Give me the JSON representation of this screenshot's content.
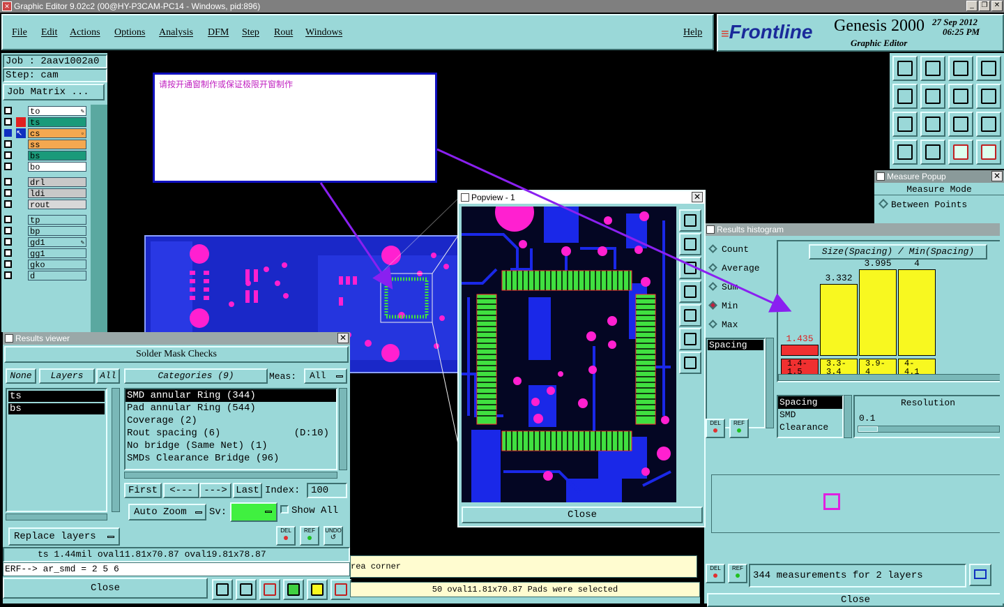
{
  "window_title": "Graphic Editor 9.02c2 (00@HY-P3CAM-PC14 - Windows, pid:896)",
  "menu": {
    "file": "File",
    "edit": "Edit",
    "actions": "Actions",
    "options": "Options",
    "analysis": "Analysis",
    "dfm": "DFM",
    "step": "Step",
    "rout": "Rout",
    "windows": "Windows",
    "help": "Help"
  },
  "brand": {
    "logo": "Frontline",
    "product": "Genesis 2000",
    "subtitle": "Graphic Editor",
    "date": "27 Sep 2012",
    "time": "06:25 PM"
  },
  "job": {
    "job_line": "Job : 2aav1002a0",
    "step_line": "Step: cam",
    "matrix_button": "Job Matrix ..."
  },
  "layers": [
    {
      "name": "to",
      "color": "#ffffff",
      "mark": "",
      "extra": "✎"
    },
    {
      "name": "ts",
      "color": "#1a9a7a",
      "mark": "#e02020",
      "extra": ""
    },
    {
      "name": "cs",
      "color": "#f4a850",
      "mark": "#1030c0",
      "extra": "▫"
    },
    {
      "name": "ss",
      "color": "#f4a850",
      "mark": "",
      "extra": ""
    },
    {
      "name": "bs",
      "color": "#1a9a7a",
      "mark": "",
      "extra": ""
    },
    {
      "name": "bo",
      "color": "#ffffff",
      "mark": "",
      "extra": ""
    },
    {
      "name": "drl",
      "color": "#c8c8c8",
      "mark": "",
      "extra": ""
    },
    {
      "name": "ldi",
      "color": "#c8c8c8",
      "mark": "",
      "extra": ""
    },
    {
      "name": "rout",
      "color": "#d8d8d8",
      "mark": "",
      "extra": ""
    },
    {
      "name": "tp",
      "color": "#9ad8d8",
      "mark": "",
      "extra": ""
    },
    {
      "name": "bp",
      "color": "#9ad8d8",
      "mark": "",
      "extra": ""
    },
    {
      "name": "gd1",
      "color": "#9ad8d8",
      "mark": "",
      "extra": "✎"
    },
    {
      "name": "gg1",
      "color": "#9ad8d8",
      "mark": "",
      "extra": ""
    },
    {
      "name": "gko",
      "color": "#9ad8d8",
      "mark": "",
      "extra": ""
    },
    {
      "name": "d",
      "color": "#9ad8d8",
      "mark": "",
      "extra": ""
    }
  ],
  "note": {
    "text": "请按开通窗制作或保证极限开窗制作"
  },
  "popview": {
    "title": "Popview - 1",
    "close": "Close"
  },
  "measure_popup": {
    "title": "Measure Popup",
    "mode_label": "Measure Mode",
    "option": "Between Points"
  },
  "histogram": {
    "title": "Results histogram",
    "radio": [
      "Count",
      "Average",
      "Sum",
      "Min",
      "Max"
    ],
    "selected": "Min",
    "header": "Size(Spacing) / Min(Spacing)",
    "list_selected": "Spacing",
    "bins": [
      {
        "label": "1.4-\n1.5",
        "value": "1.435",
        "color": "#f03030"
      },
      {
        "label": "3.3-\n3.4",
        "value": "3.332",
        "color": "#f8f820"
      },
      {
        "label": "3.9-\n4",
        "value": "3.995",
        "color": "#f8f820"
      },
      {
        "label": "4-\n4.1",
        "value": "4",
        "color": "#f8f820"
      }
    ],
    "types": [
      "Spacing",
      "SMD",
      "Clearance"
    ],
    "resolution_label": "Resolution",
    "resolution_value": "0.1",
    "status": "344 measurements for 2 layers",
    "close": "Close",
    "del": "DEL",
    "ref": "REF"
  },
  "results_viewer": {
    "title": "Results viewer",
    "heading": "Solder Mask Checks",
    "none_btn": "None",
    "layers_btn": "Layers",
    "all_btn": "All",
    "categories_btn": "Categories (9)",
    "meas_label": "Meas:",
    "meas_value": "All",
    "layer_list": [
      "ts",
      "bs"
    ],
    "categories": [
      {
        "name": "SMD annular Ring (344)",
        "extra": ""
      },
      {
        "name": "Pad annular Ring (544)",
        "extra": ""
      },
      {
        "name": "Coverage (2)",
        "extra": ""
      },
      {
        "name": "Rout spacing (6)",
        "extra": "(D:10)"
      },
      {
        "name": "No bridge (Same Net) (1)",
        "extra": ""
      },
      {
        "name": "SMDs Clearance Bridge (96)",
        "extra": ""
      }
    ],
    "first": "First",
    "prev": "<---",
    "next": "--->",
    "last": "Last",
    "index_label": "Index:",
    "index_value": "100",
    "auto_zoom": "Auto Zoom",
    "sv_label": "Sv:",
    "show_all": "Show All",
    "replace_layers": "Replace layers",
    "del": "DEL",
    "ref": "REF",
    "undo": "UNDO"
  },
  "status": {
    "coords": "ts 1.44mil   oval11.81x70.87  oval19.81x78.87",
    "erf": "ERF--> ar_smd = 2 5 6",
    "close": "Close",
    "area_corner": "rea corner",
    "selected": "50 oval11.81x70.87 Pads were selected"
  }
}
